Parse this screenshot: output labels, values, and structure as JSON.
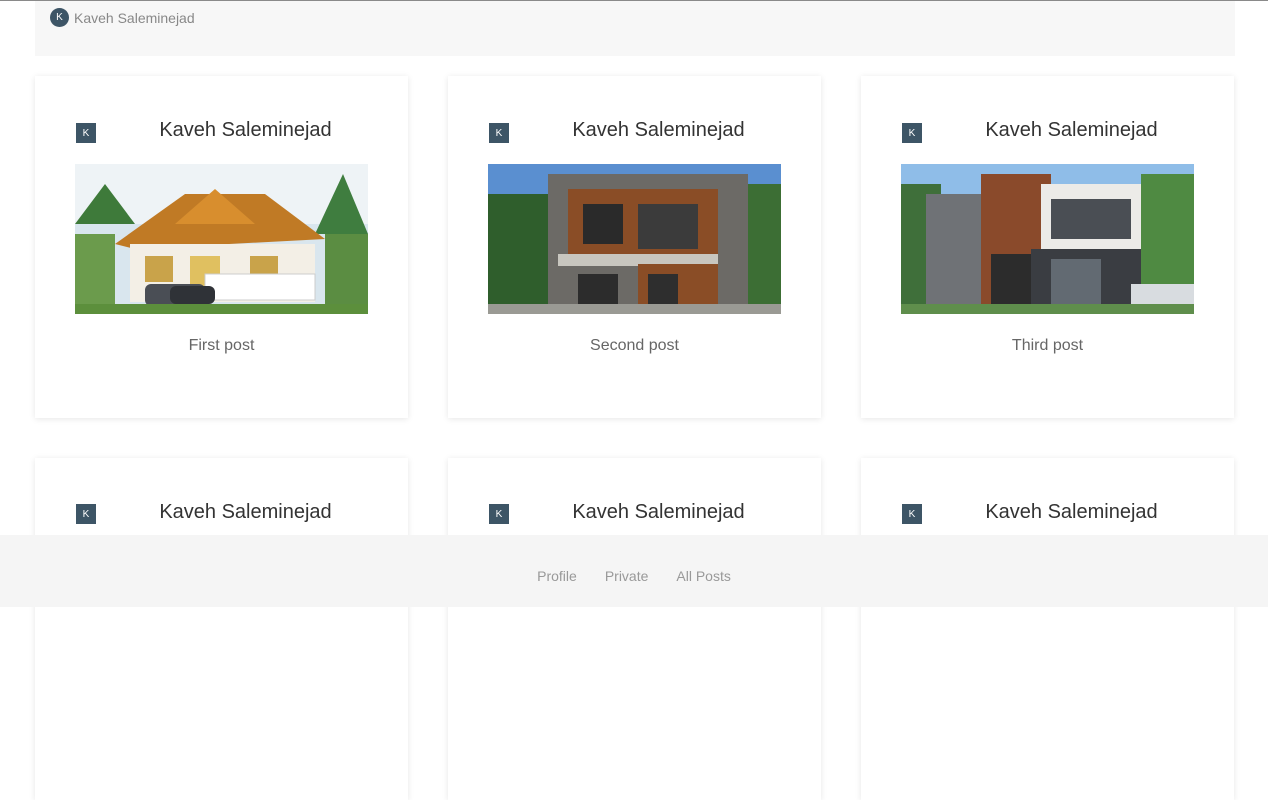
{
  "header": {
    "avatar_initial": "K",
    "user_name": "Kaveh Saleminejad"
  },
  "posts": [
    {
      "avatar_initial": "K",
      "author": "Kaveh Saleminejad",
      "caption": "First post",
      "image": "traditional-house-photo"
    },
    {
      "avatar_initial": "K",
      "author": "Kaveh Saleminejad",
      "caption": "Second post",
      "image": "modern-wood-house-photo"
    },
    {
      "avatar_initial": "K",
      "author": "Kaveh Saleminejad",
      "caption": "Third post",
      "image": "modern-white-box-house-photo"
    },
    {
      "avatar_initial": "K",
      "author": "Kaveh Saleminejad"
    },
    {
      "avatar_initial": "K",
      "author": "Kaveh Saleminejad"
    },
    {
      "avatar_initial": "K",
      "author": "Kaveh Saleminejad"
    }
  ],
  "footer": {
    "links": [
      "Profile",
      "Private",
      "All Posts"
    ]
  },
  "colors": {
    "avatar": "#3d5566",
    "footer_bg": "#f5f5f5",
    "header_bg": "#f7f7f7"
  }
}
